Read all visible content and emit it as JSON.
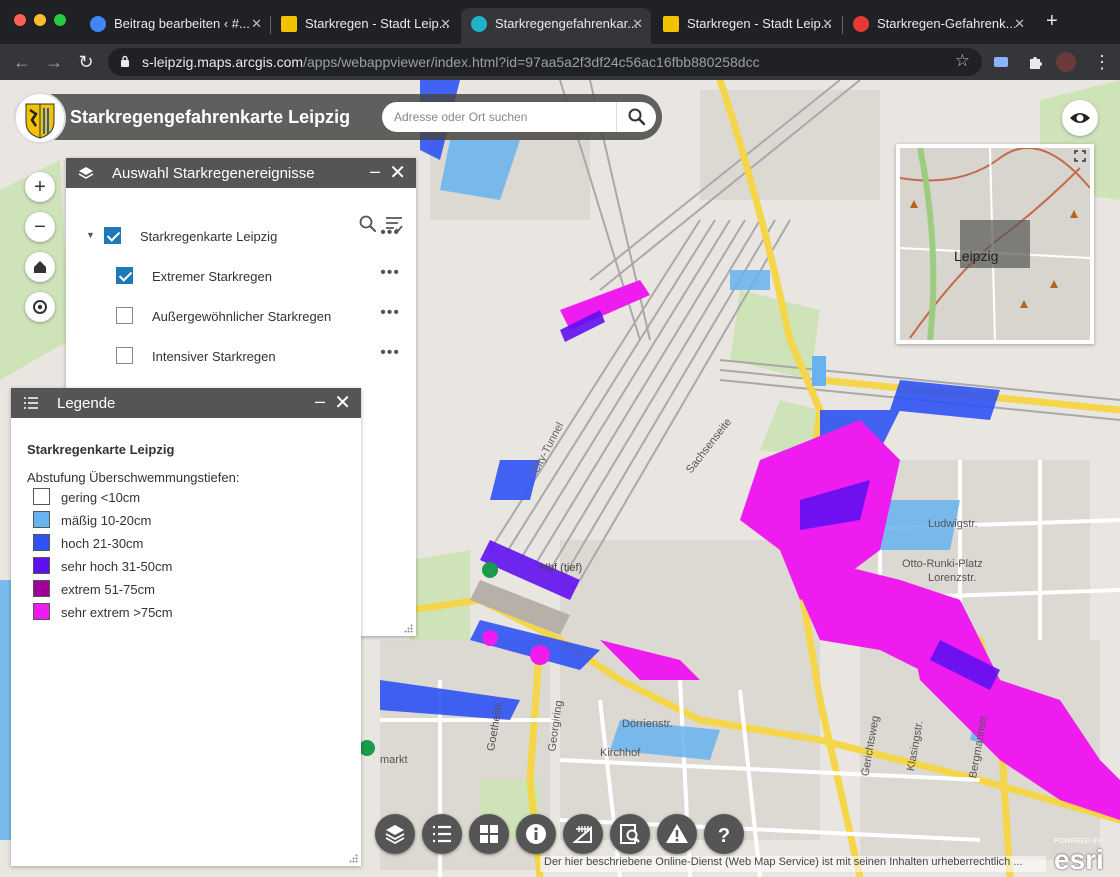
{
  "browser": {
    "tabs": [
      {
        "title": "Beitrag bearbeiten ‹ #...",
        "favicon_color": "#4285f4",
        "icon": "wordpress-icon"
      },
      {
        "title": "Starkregen - Stadt Leip...",
        "favicon_color": "#f2c200",
        "icon": "leipzig-crest-icon"
      },
      {
        "title": "Starkregengefahrenkar...",
        "favicon_color": "#1fb3c9",
        "icon": "arcgis-icon"
      },
      {
        "title": "Starkregen - Stadt Leip...",
        "favicon_color": "#f2c200",
        "icon": "leipzig-crest-icon"
      },
      {
        "title": "Starkregen-Gefahrenk...",
        "favicon_color": "#e53935",
        "icon": "target-icon"
      }
    ],
    "url_host": "s-leipzig.maps.arcgis.com",
    "url_path": "/apps/webappviewer/index.html?id=97aa5a2f3df24c56ac16fbb880258dcc"
  },
  "app": {
    "title": "Starkregengefahrenkarte Leipzig",
    "search_placeholder": "Adresse oder Ort suchen"
  },
  "layers_panel": {
    "title": "Auswahl Starkregenereignisse",
    "group": {
      "label": "Starkregenkarte Leipzig",
      "checked": true
    },
    "items": [
      {
        "label": "Extremer Starkregen",
        "checked": true
      },
      {
        "label": "Außergewöhnlicher Starkregen",
        "checked": false
      },
      {
        "label": "Intensiver Starkregen",
        "checked": false
      }
    ],
    "more_label": "•••"
  },
  "legend_panel": {
    "title": "Legende",
    "layer_title": "Starkregenkarte Leipzig",
    "subtitle": "Abstufung Überschwemmungstiefen:",
    "items": [
      {
        "label": "gering <10cm",
        "color": "#ffffff"
      },
      {
        "label": "mäßig 10-20cm",
        "color": "#66b3f0"
      },
      {
        "label": "hoch 21-30cm",
        "color": "#2f53f5"
      },
      {
        "label": "sehr hoch 31-50cm",
        "color": "#6010f0"
      },
      {
        "label": "extrem 51-75cm",
        "color": "#a0009a"
      },
      {
        "label": "sehr extrem >75cm",
        "color": "#ee1cef"
      }
    ]
  },
  "overview_map": {
    "label": "Leipzig"
  },
  "map_labels": {
    "sachsenseite": "Sachsenseite",
    "ludwig": "Ludwigstr.",
    "otto": "Otto-Runki-Platz",
    "lorenz": "Lorenzstr.",
    "goethe": "Goethestr.",
    "georgi": "Georgiring",
    "doerrien": "Dörrienstr.",
    "kirchhof": "Kirchhof",
    "bergmann": "Bergmannstr.",
    "klasing": "Klasingstr.",
    "gerichtsweg": "Gerichtsweg",
    "markt": "markt",
    "hbf": "Hbf (tief)",
    "tunnel": "City-Tunnel",
    "sachsenseite2": "Sachsenseite"
  },
  "attribution": "Der hier beschriebene Online-Dienst (Web Map Service) ist mit seinen Inhalten urheberrechtlich ...",
  "esri": {
    "powered": "POWERED BY",
    "logo": "esri"
  },
  "colors": {
    "header": "#555555",
    "accent": "#1d7ab8",
    "flood_light": "#66b3f0",
    "flood_mid": "#2f53f5",
    "flood_high": "#6010f0",
    "flood_extreme": "#ee1cef"
  }
}
